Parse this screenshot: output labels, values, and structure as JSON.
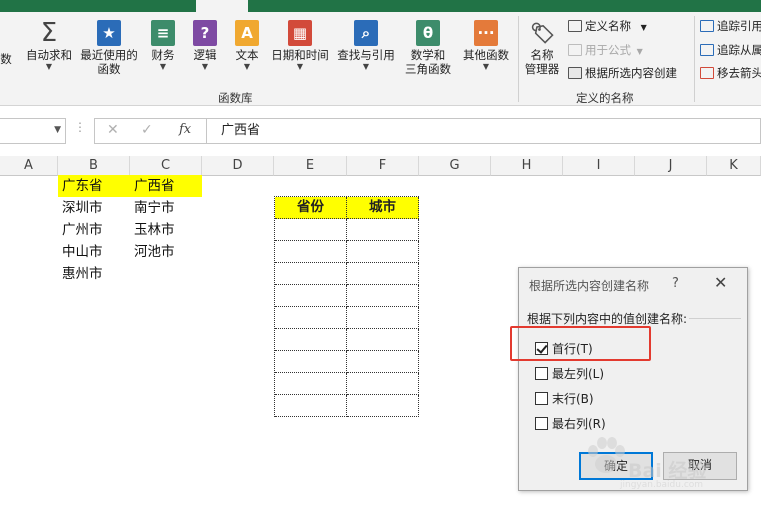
{
  "ribbon": {
    "group1": {
      "label": "函数库",
      "buttons": [
        {
          "label": "数",
          "icon": "insert-function-icon"
        },
        {
          "label": "自动求和",
          "icon": "sigma-icon"
        },
        {
          "label": "最近使用的\n函数",
          "icon": "star-book-icon"
        },
        {
          "label": "财务",
          "icon": "coins-book-icon"
        },
        {
          "label": "逻辑",
          "icon": "question-book-icon"
        },
        {
          "label": "文本",
          "icon": "text-a-book-icon"
        },
        {
          "label": "日期和时间",
          "icon": "calendar-book-icon"
        },
        {
          "label": "查找与引用",
          "icon": "magnifier-book-icon"
        },
        {
          "label": "数学和\n三角函数",
          "icon": "theta-book-icon"
        },
        {
          "label": "其他函数",
          "icon": "dots-book-icon"
        }
      ]
    },
    "group2": {
      "label": "定义的名称",
      "name_manager": "名称\n管理器",
      "define_name": "定义名称",
      "use_in_formula": "用于公式",
      "create_from_selection": "根据所选内容创建"
    },
    "group3": {
      "trace_precedents": "追踪引用",
      "trace_dependents": "追踪从属",
      "remove_arrows": "移去箭头"
    }
  },
  "formula_bar": {
    "name_box": "",
    "cancel": "✕",
    "enter": "✓",
    "fx": "fx",
    "formula": "广西省"
  },
  "columns": [
    "A",
    "B",
    "C",
    "D",
    "E",
    "F",
    "G",
    "H",
    "I",
    "J",
    "K"
  ],
  "cells": {
    "B": [
      "广东省",
      "深圳市",
      "广州市",
      "中山市",
      "惠州市"
    ],
    "C": [
      "广西省",
      "南宁市",
      "玉林市",
      "河池市"
    ]
  },
  "inner_table": {
    "headers": [
      "省份",
      "城市"
    ]
  },
  "dialog": {
    "title": "根据所选内容创建名称",
    "help": "?",
    "close": "✕",
    "prompt": "根据下列内容中的值创建名称:",
    "options": [
      {
        "label": "首行(T)",
        "checked": true
      },
      {
        "label": "最左列(L)",
        "checked": false
      },
      {
        "label": "末行(B)",
        "checked": false
      },
      {
        "label": "最右列(R)",
        "checked": false
      }
    ],
    "ok": "确定",
    "cancel": "取消"
  },
  "colors": {
    "highlight": "#ffff00",
    "annotation": "#e33a2f",
    "excel_green": "#217346"
  },
  "watermark": {
    "text": "Bai 经验",
    "sub": "jingyan.baidu.com"
  }
}
